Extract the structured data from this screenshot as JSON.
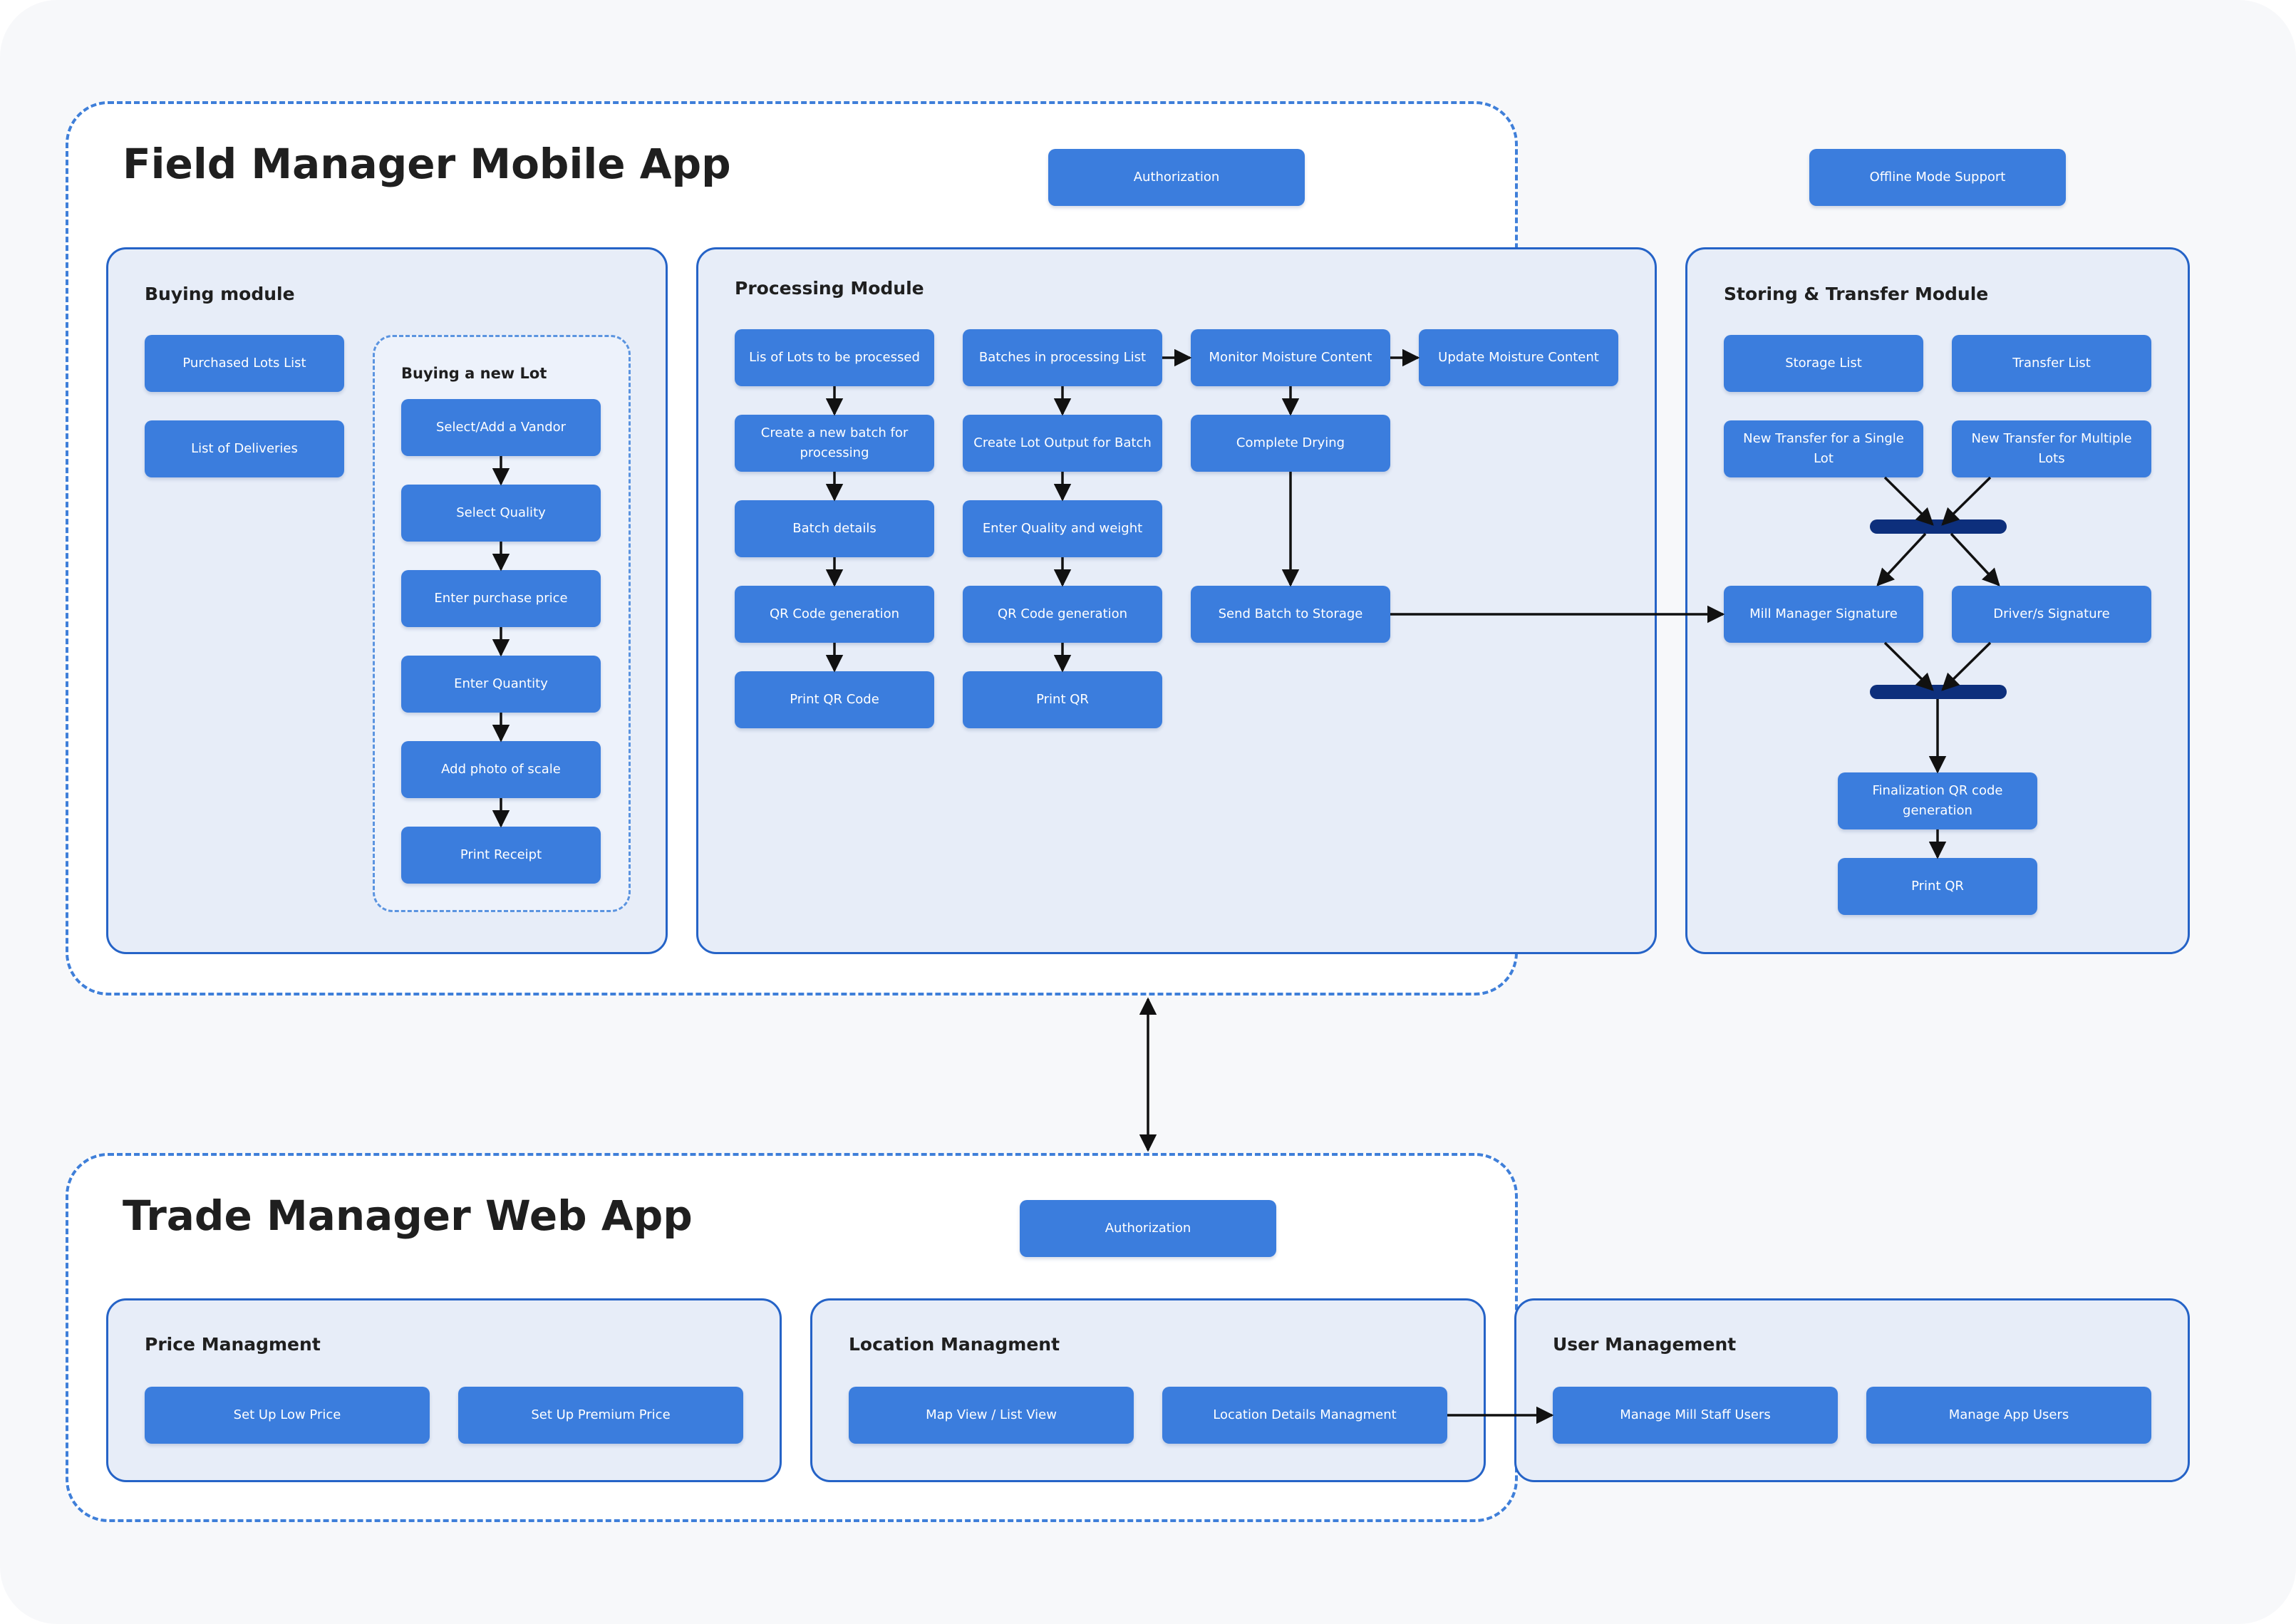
{
  "field_app": {
    "title": "Field Manager Mobile App",
    "authorization": "Authorization",
    "offline": "Offline Mode Support",
    "buying": {
      "title": "Buying module",
      "purchased_lots": "Purchased Lots List",
      "deliveries": "List of Deliveries",
      "new_lot": {
        "title": "Buying a new Lot",
        "steps": [
          "Select/Add a Vandor",
          "Select Quality",
          "Enter purchase price",
          "Enter Quantity",
          "Add photo of scale",
          "Print Receipt"
        ]
      }
    },
    "processing": {
      "title": "Processing Module",
      "col1": [
        "Lis of Lots to be processed",
        "Create a new batch for processing",
        "Batch details",
        "QR Code generation",
        "Print QR Code"
      ],
      "col2": [
        "Batches in processing List",
        "Create Lot Output for Batch",
        "Enter Quality and weight",
        "QR Code generation",
        "Print QR"
      ],
      "monitor": "Monitor Moisture Content",
      "update": "Update Moisture Content",
      "complete": "Complete Drying",
      "send": "Send Batch to Storage"
    },
    "storing": {
      "title": "Storing & Transfer Module",
      "storage_list": "Storage List",
      "transfer_list": "Transfer List",
      "new_single": "New Transfer for a Single Lot",
      "new_multiple": "New Transfer for Multiple Lots",
      "mill_signature": "Mill Manager Signature",
      "driver_signature": "Driver/s Signature",
      "finalization": "Finalization QR code generation",
      "print_qr": "Print QR"
    }
  },
  "trade_app": {
    "title": "Trade Manager Web App",
    "authorization": "Authorization",
    "price": {
      "title": "Price Managment",
      "low": "Set Up Low Price",
      "premium": "Set Up Premium Price"
    },
    "location": {
      "title": "Location Managment",
      "map": "Map View / List View",
      "details": "Location Details Managment"
    },
    "users": {
      "title": "User Management",
      "mill_staff": "Manage Mill Staff Users",
      "app_users": "Manage App Users"
    }
  },
  "colors": {
    "box": "#3b7ddd",
    "module_fill": "#e7edf8",
    "module_border": "#2563c7",
    "bar": "#0d2f7c",
    "dash": "#3f7fd9"
  }
}
